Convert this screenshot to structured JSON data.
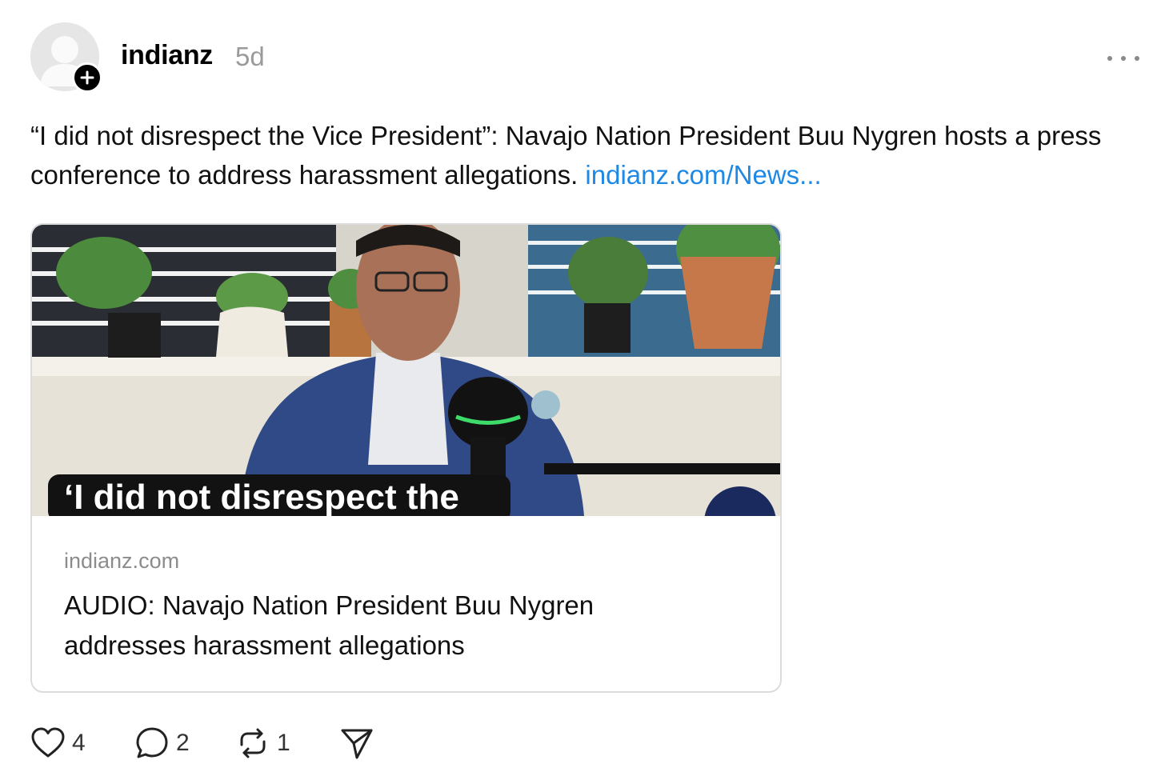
{
  "post": {
    "author": "indianz",
    "time": "5d",
    "text": "“I did not disrespect the Vice President”: Navajo Nation President Buu Nygren hosts a press conference to address harassment allegations.",
    "link": "indianz.com/News..."
  },
  "card": {
    "image_caption": "‘I did not disrespect the",
    "domain": "indianz.com",
    "title": "AUDIO: Navajo Nation President Buu Nygren addresses harassment allegations"
  },
  "actions": {
    "likes": "4",
    "comments": "2",
    "reposts": "1"
  },
  "icons": {
    "avatar": "default-avatar-icon",
    "follow": "plus-icon",
    "more": "more-horizontal-icon",
    "like": "heart-icon",
    "comment": "comment-bubble-icon",
    "repost": "repost-icon",
    "share": "send-icon"
  },
  "colors": {
    "link": "#1e88e5",
    "timestamp": "#9a9a9a",
    "card_border": "#dcdcdc"
  }
}
